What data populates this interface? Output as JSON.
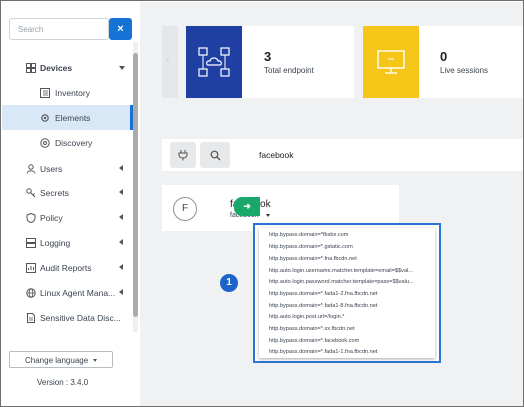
{
  "sidebar": {
    "search_placeholder": "Search",
    "clear_label": "×",
    "items": [
      {
        "label": "Devices"
      },
      {
        "label": "Inventory"
      },
      {
        "label": "Elements"
      },
      {
        "label": "Discovery"
      },
      {
        "label": "Users"
      },
      {
        "label": "Secrets"
      },
      {
        "label": "Policy"
      },
      {
        "label": "Logging"
      },
      {
        "label": "Audit Reports"
      },
      {
        "label": "Linux Agent Mana..."
      },
      {
        "label": "Sensitive Data Disc..."
      }
    ],
    "language_button": "Change language",
    "version": "Version : 3.4.0"
  },
  "stats": {
    "endpoints": {
      "value": "3",
      "label": "Total endpoint"
    },
    "sessions": {
      "value": "0",
      "label": "Live sessions"
    }
  },
  "filter": {
    "text": "facebook"
  },
  "app_card": {
    "avatar": "F",
    "title": "facebook",
    "subtitle": "facebook",
    "go_label": "➜"
  },
  "dropdown": {
    "items": [
      "http.bypass.domain=*fbsbx.com",
      "http.bypass.domain=*.gstatic.com",
      "http.bypass.domain=*.fna.fbcdn.net",
      "http.auto.login.username.matcher.template=email=$$val...",
      "http.auto.login.password.matcher.template=pass=$$valu...",
      "http.bypass.domain=*.fada1-2.fna.fbcdn.net",
      "http.bypass.domain=*.fada1-8.fna.fbcdn.net",
      "http.auto.login.post.url=/login.*",
      "http.bypass.domain=*.xx.fbcdn.net",
      "http.bypass.domain=*.facebook.com",
      "http.bypass.domain=*.fada1-1.fna.fbcdn.net"
    ]
  },
  "callout": "1",
  "colors": {
    "accent": "#1673d6",
    "endpoint_tile": "#1f3fa3",
    "sessions_tile": "#f5c518",
    "go_button": "#1aa86a",
    "highlight_border": "#2c73d2"
  }
}
